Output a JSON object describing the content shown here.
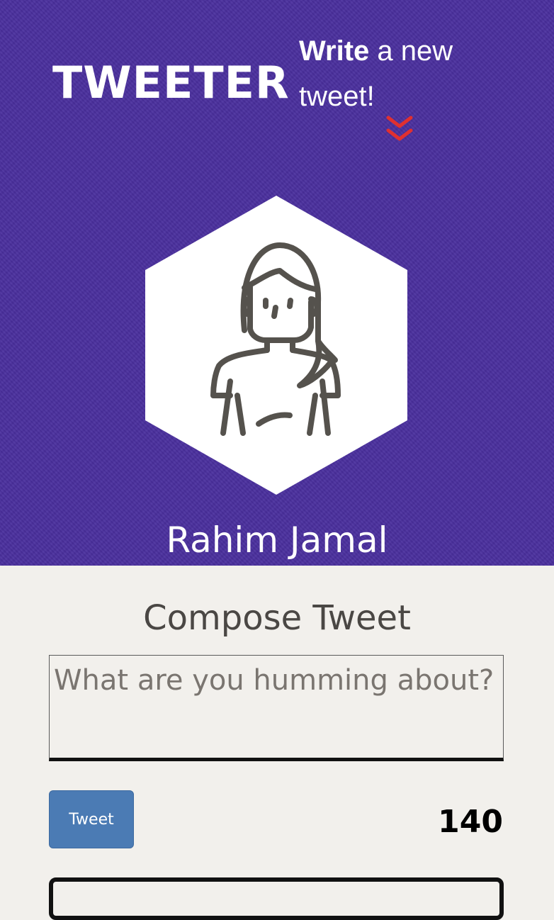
{
  "nav": {
    "logo_text": "TWEETER",
    "write_bold": "Write",
    "write_rest_1": " a new",
    "write_rest_2": "tweet!",
    "toggle_icon": "double-chevron-down-icon",
    "toggle_color": "#e03030"
  },
  "profile": {
    "name": "Rahim Jamal",
    "avatar_icon": "woman-avatar-icon"
  },
  "compose": {
    "title": "Compose Tweet",
    "placeholder": "What are you humming about?",
    "value": "",
    "button_label": "Tweet",
    "char_counter": "140"
  },
  "colors": {
    "header_bg": "#4a2f9e",
    "page_bg": "#f2f0ec",
    "button_bg": "#4b7bb4"
  }
}
